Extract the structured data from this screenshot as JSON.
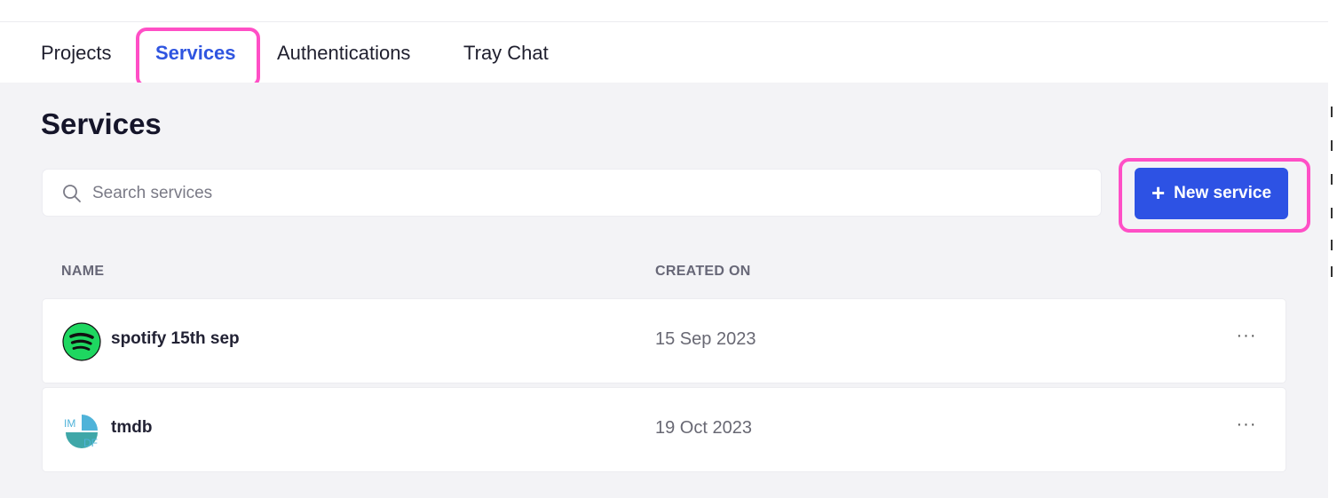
{
  "tabs": [
    {
      "label": "Projects",
      "active": false
    },
    {
      "label": "Services",
      "active": true
    },
    {
      "label": "Authentications",
      "active": false
    },
    {
      "label": "Tray Chat",
      "active": false
    }
  ],
  "page": {
    "title": "Services"
  },
  "search": {
    "placeholder": "Search services",
    "value": "",
    "icon": "search-icon"
  },
  "new_button": {
    "label": "New service",
    "icon": "plus-icon",
    "color": "#2d52e4"
  },
  "table": {
    "headers": [
      "NAME",
      "CREATED ON"
    ],
    "rows": [
      {
        "name": "spotify 15th sep",
        "created_on": "15 Sep 2023",
        "logo": "spotify-logo",
        "menu": "···"
      },
      {
        "name": "tmdb",
        "created_on": "19 Oct 2023",
        "logo": "tmdb-logo",
        "menu": "···",
        "logo_text": "IMDF"
      }
    ]
  },
  "colors": {
    "accent": "#2f55e0",
    "highlight": "#ff4fc6",
    "background": "#f3f3f6"
  }
}
